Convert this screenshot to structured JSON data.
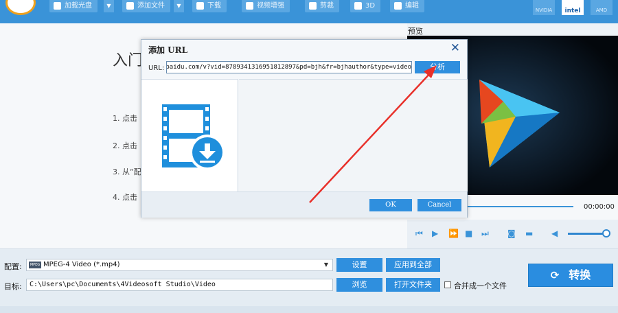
{
  "toolbar": {
    "buttons": [
      "加载光盘",
      "添加文件",
      "下载",
      "视频增强",
      "剪裁",
      "3D",
      "编辑"
    ],
    "gpu": [
      "NVIDIA",
      "intel",
      "AMD"
    ]
  },
  "intro": {
    "title": "入门",
    "steps": [
      "1. 点击",
      "2. 点击",
      "3. 从“配",
      "4. 点击"
    ]
  },
  "preview": {
    "label": "预览",
    "time": "00:00:00"
  },
  "dialog": {
    "title": "添加 URL",
    "url_label": "URL:",
    "url_value": ".baidu.com/v?vid=8789341316951812897&pd=bjh&fr=bjhauthor&type=video",
    "analyze_label": "分析",
    "ok_label": "OK",
    "cancel_label": "Cancel"
  },
  "bottom": {
    "profile_label": "配置:",
    "profile_value": "MPEG-4 Video (*.mp4)",
    "profile_icon_text": "MPEG",
    "settings_label": "设置",
    "apply_all_label": "应用到全部",
    "target_label": "目标:",
    "target_value": "C:\\Users\\pc\\Documents\\4Videosoft Studio\\Video",
    "browse_label": "浏览",
    "open_folder_label": "打开文件夹",
    "merge_label": "合并成一个文件",
    "convert_label": "转换"
  },
  "colors": {
    "accent": "#3a93d8",
    "button": "#2f8fde",
    "annotation_arrow": "#e8302a"
  }
}
